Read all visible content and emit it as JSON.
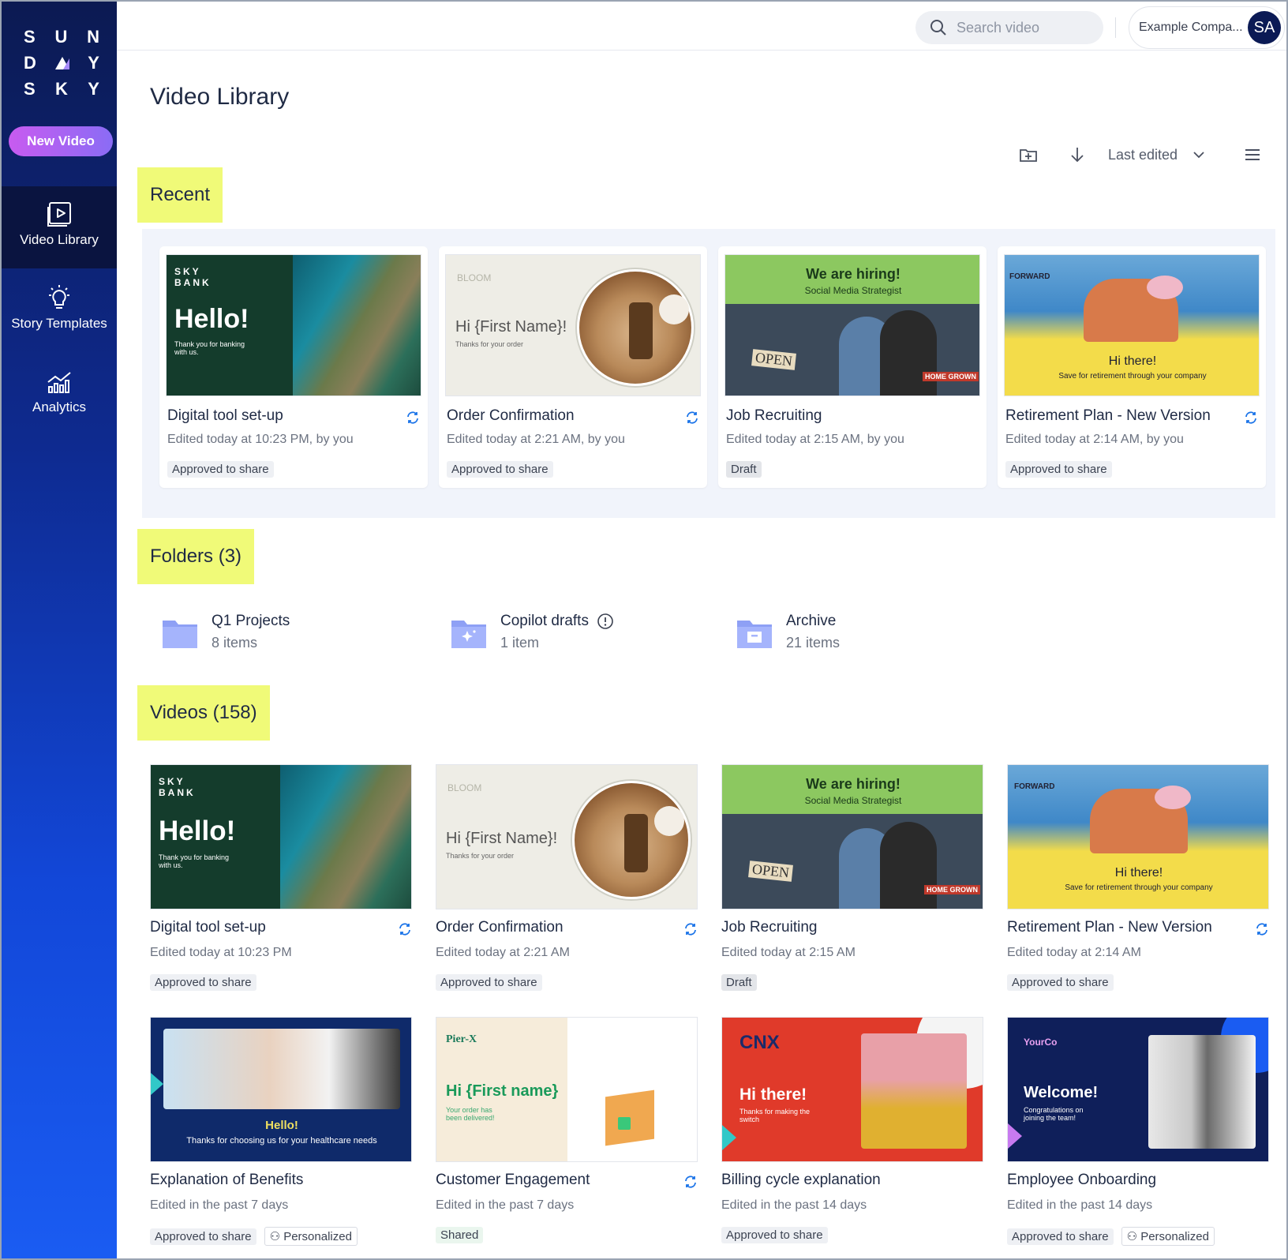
{
  "brand": {
    "logo_rows": [
      [
        "S",
        "U",
        "N"
      ],
      [
        "D",
        "",
        "Y"
      ],
      [
        "S",
        "K",
        "Y"
      ]
    ]
  },
  "sidebar": {
    "new_video_label": "New Video",
    "items": [
      {
        "label": "Video Library",
        "icon": "play-square-icon",
        "active": true
      },
      {
        "label": "Story Templates",
        "icon": "lightbulb-icon",
        "active": false
      },
      {
        "label": "Analytics",
        "icon": "chart-icon",
        "active": false
      }
    ]
  },
  "header": {
    "search_placeholder": "Search video",
    "account_name": "Example Compa...",
    "avatar_initials": "SA"
  },
  "page": {
    "title": "Video Library"
  },
  "toolbar": {
    "sort_label": "Last edited"
  },
  "sections": {
    "recent": "Recent",
    "folders": "Folders (3)",
    "videos": "Videos (158)"
  },
  "recent": [
    {
      "title": "Digital tool set-up",
      "edited": "Edited today at 10:23 PM, by you",
      "badges": [
        "Approved to share"
      ],
      "sync": true
    },
    {
      "title": "Order Confirmation",
      "edited": "Edited today at 2:21 AM, by you",
      "badges": [
        "Approved to share"
      ],
      "sync": true
    },
    {
      "title": "Job Recruiting",
      "edited": "Edited today at 2:15 AM, by you",
      "badges": [
        "Draft"
      ],
      "sync": false
    },
    {
      "title": "Retirement Plan - New Version",
      "edited": "Edited today at 2:14 AM, by you",
      "badges": [
        "Approved to share"
      ],
      "sync": true
    }
  ],
  "folders": [
    {
      "name": "Q1 Projects",
      "count": "8 items",
      "icon": "folder-icon"
    },
    {
      "name": "Copilot drafts",
      "count": "1 item",
      "icon": "sparkle-folder-icon",
      "info": true
    },
    {
      "name": "Archive",
      "count": "21 items",
      "icon": "archive-folder-icon"
    }
  ],
  "videos": [
    {
      "title": "Digital tool set-up",
      "edited": "Edited today at 10:23 PM",
      "badges": [
        "Approved to share"
      ],
      "sync": true
    },
    {
      "title": "Order Confirmation",
      "edited": "Edited today at 2:21 AM",
      "badges": [
        "Approved to share"
      ],
      "sync": true
    },
    {
      "title": "Job Recruiting",
      "edited": "Edited today at 2:15 AM",
      "badges": [
        "Draft"
      ],
      "sync": false
    },
    {
      "title": "Retirement Plan - New Version",
      "edited": "Edited today at 2:14 AM",
      "badges": [
        "Approved to share"
      ],
      "sync": true
    },
    {
      "title": "Explanation of Benefits",
      "edited": "Edited in the past 7 days",
      "badges": [
        "Approved to share",
        "Personalized"
      ],
      "sync": false
    },
    {
      "title": "Customer Engagement",
      "edited": "Edited in the past 7 days",
      "badges": [
        "Shared"
      ],
      "sync": true
    },
    {
      "title": "Billing cycle explanation",
      "edited": "Edited in the past 14 days",
      "badges": [
        "Approved to share"
      ],
      "sync": false
    },
    {
      "title": "Employee Onboarding",
      "edited": "Edited in the past 14 days",
      "badges": [
        "Approved to share",
        "Personalized"
      ],
      "sync": false
    }
  ],
  "thumbs": {
    "skybank": {
      "brand": "SKY BANK",
      "headline": "Hello!",
      "sub": "Thank you for banking with us."
    },
    "bloom": {
      "brand": "BLOOM",
      "headline": "Hi {First Name}!",
      "sub": "Thanks for your order"
    },
    "hiring": {
      "headline": "We are hiring!",
      "sub": "Social Media Strategist",
      "sign": "OPEN",
      "store": "HOME GROWN"
    },
    "forward": {
      "brand": "FORWARD",
      "headline": "Hi there!",
      "sub": "Save for retirement through your company"
    },
    "benefits": {
      "headline": "Hello!",
      "sub": "Thanks for choosing us for your healthcare needs"
    },
    "pierx": {
      "brand": "Pier-X",
      "headline": "Hi {First name}",
      "sub": "Your order has been delivered!"
    },
    "cnx": {
      "brand": "CNX",
      "headline": "Hi there!",
      "sub": "Thanks for making the switch"
    },
    "yourco": {
      "brand": "YourCo",
      "headline": "Welcome!",
      "sub": "Congratulations on joining the team!"
    }
  },
  "colors": {
    "highlight": "#f0fa78",
    "sidebar_top": "#0c1a52",
    "sidebar_bottom": "#1a5cf2",
    "accent": "#1a73e8"
  }
}
